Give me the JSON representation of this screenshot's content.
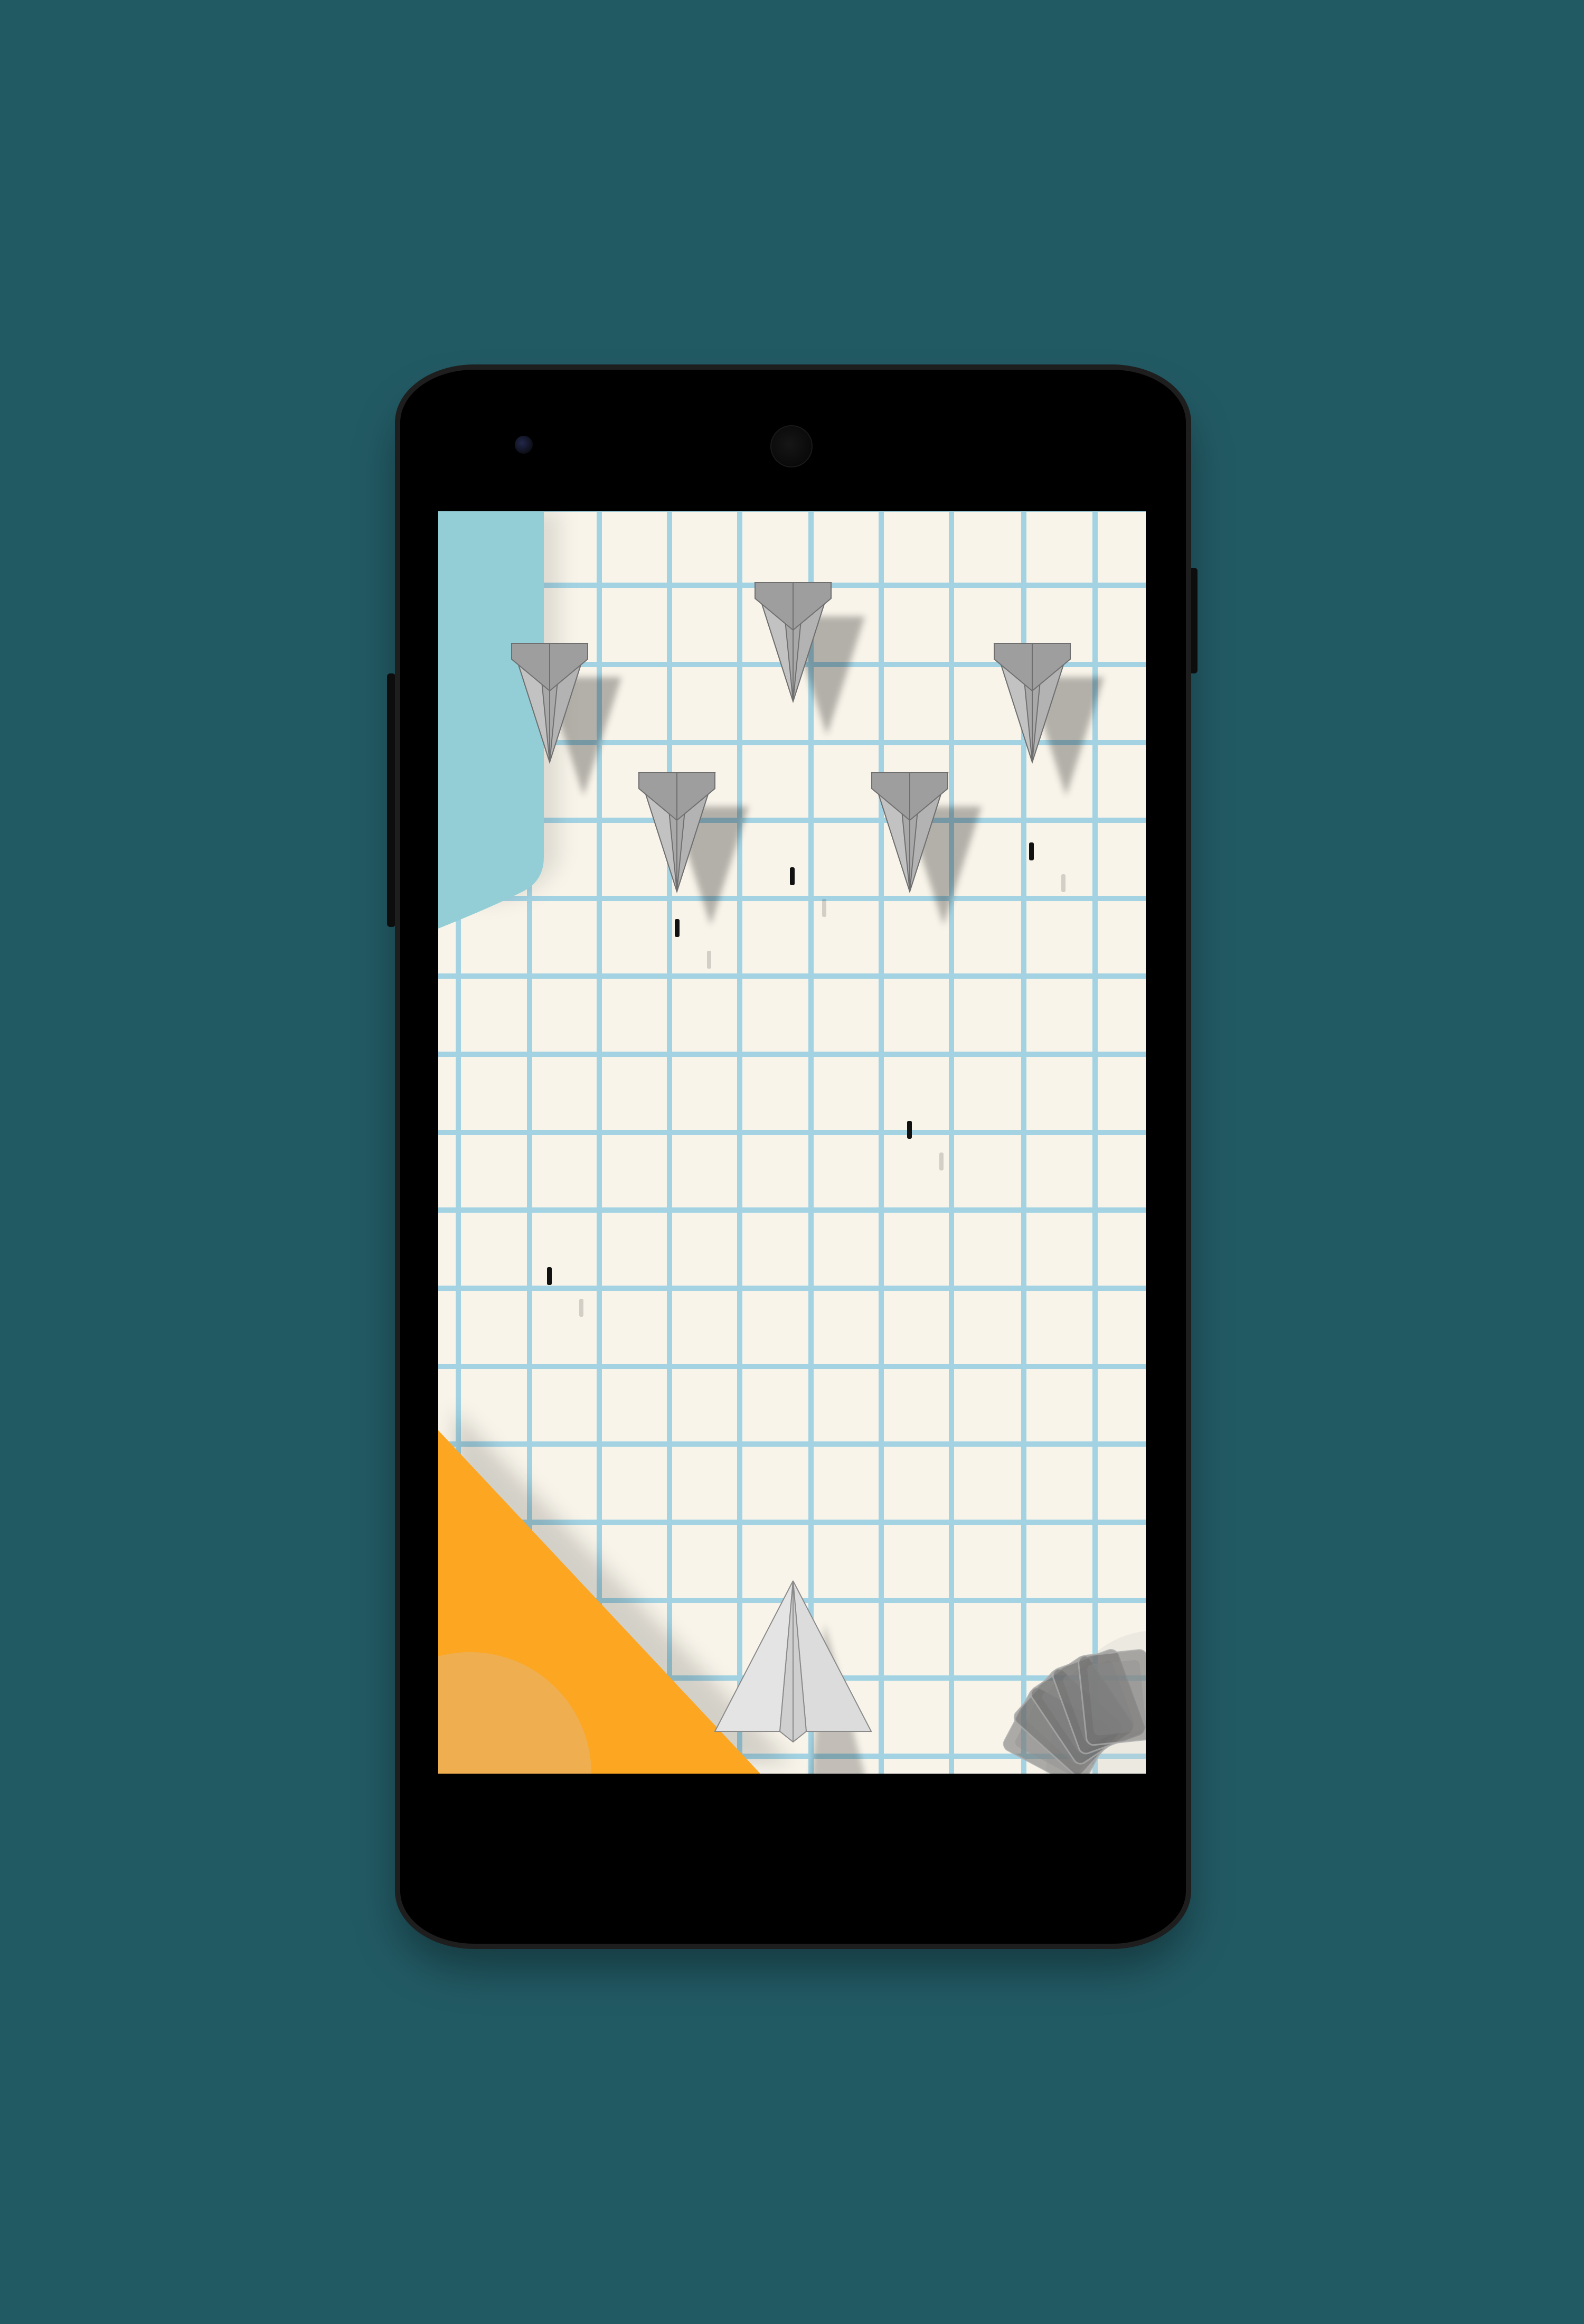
{
  "game": {
    "colors": {
      "background": "#225a64",
      "paper": "#f8f4ea",
      "grid_line": "#a3d3e3",
      "blue_paper": "#93ced6",
      "orange_paper": "#fca622",
      "enemy_plane": "#a9a9a9",
      "player_plane": "#dcdcdc",
      "bullet": "#111111"
    },
    "enemies": [
      {
        "name": "enemy-plane"
      },
      {
        "name": "enemy-plane"
      },
      {
        "name": "enemy-plane"
      },
      {
        "name": "enemy-plane"
      },
      {
        "name": "enemy-plane"
      }
    ],
    "player": {
      "icon": "paper-plane-icon"
    },
    "controls": {
      "icon": "card-fan-icon"
    },
    "bullets_count": 5
  }
}
